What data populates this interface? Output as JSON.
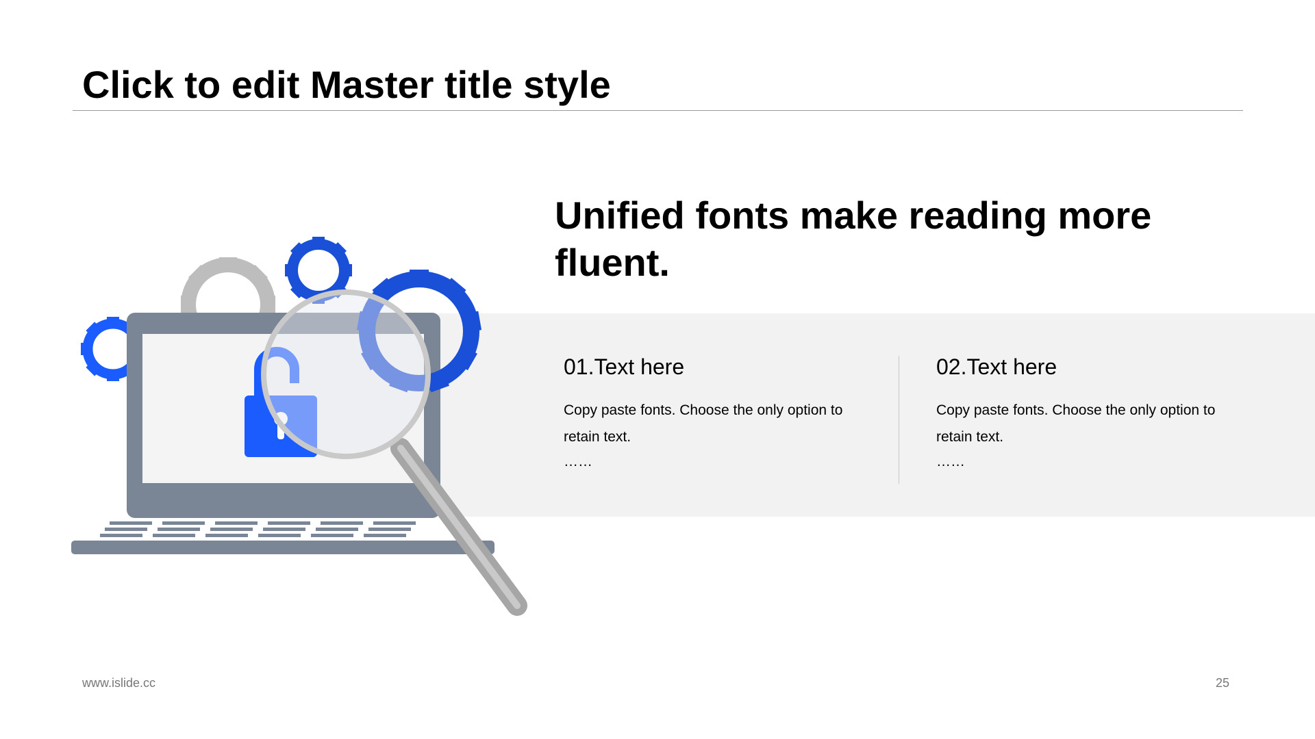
{
  "slide": {
    "title": "Click to edit Master title style",
    "headline": "Unified fonts make reading more fluent.",
    "columns": [
      {
        "heading": "01.Text here",
        "body": "Copy paste fonts. Choose the only option to retain text.",
        "ellipsis": "……"
      },
      {
        "heading": "02.Text here",
        "body": "Copy paste fonts. Choose the only option to retain text.",
        "ellipsis": "……"
      }
    ],
    "footer_url": "www.islide.cc",
    "page_number": "25"
  },
  "colors": {
    "accent_blue": "#1a4fd8",
    "light_blue": "#6e8ef5",
    "gray_gear": "#bdbdbd",
    "laptop_gray": "#7a8595",
    "band": "#f2f2f2"
  },
  "icons": [
    "gear-icon",
    "laptop-icon",
    "padlock-icon",
    "magnifier-icon"
  ]
}
